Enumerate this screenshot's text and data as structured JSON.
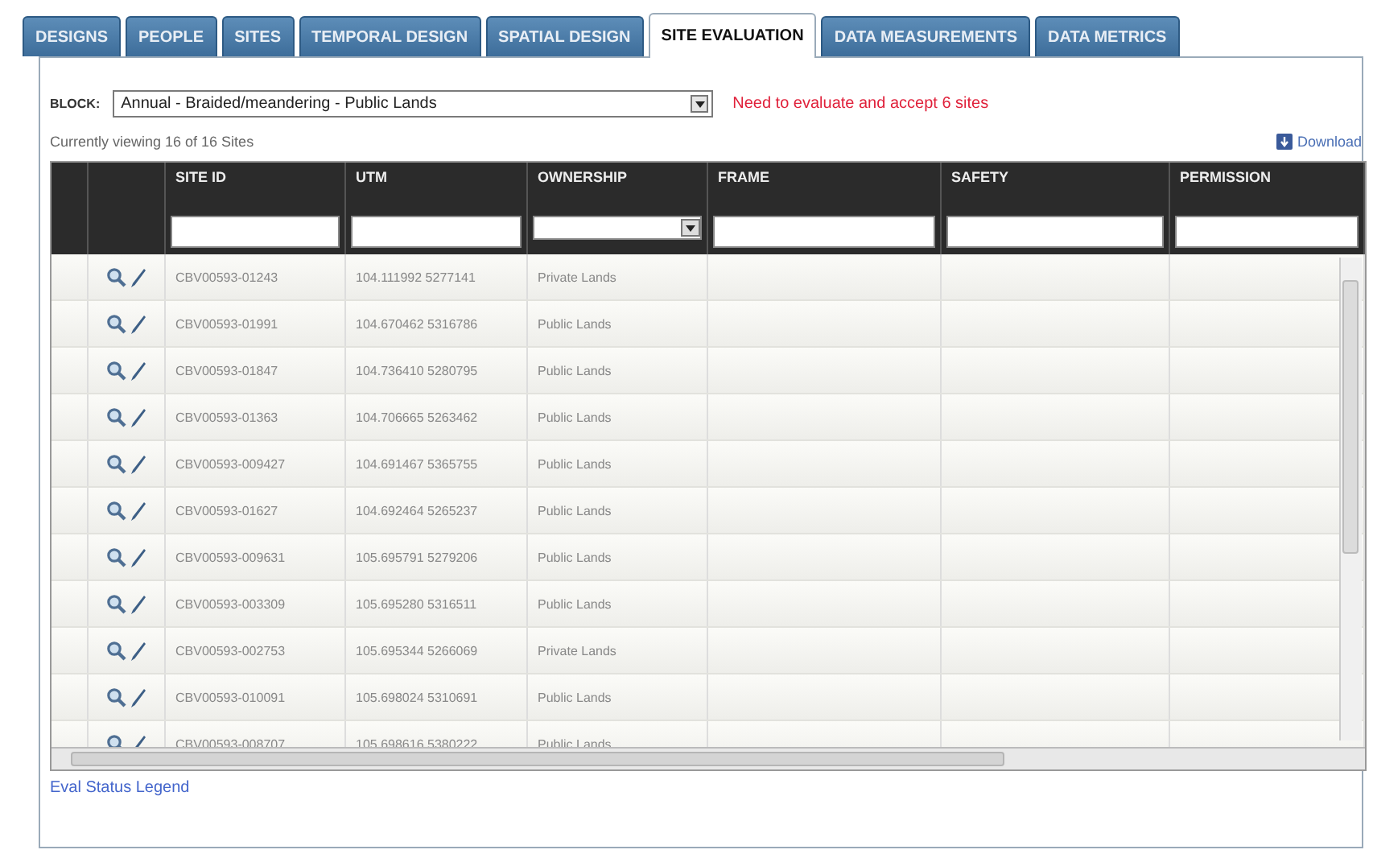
{
  "tabs": [
    {
      "label": "DESIGNS",
      "selected": false
    },
    {
      "label": "PEOPLE",
      "selected": false
    },
    {
      "label": "SITES",
      "selected": false
    },
    {
      "label": "TEMPORAL DESIGN",
      "selected": false
    },
    {
      "label": "SPATIAL DESIGN",
      "selected": false
    },
    {
      "label": "SITE EVALUATION",
      "selected": true
    },
    {
      "label": "DATA MEASUREMENTS",
      "selected": false
    },
    {
      "label": "DATA METRICS",
      "selected": false
    }
  ],
  "block": {
    "label": "BLOCK:",
    "value": "Annual - Braided/meandering - Public Lands",
    "warning": "Need to evaluate and accept 6 sites"
  },
  "viewing": "Currently viewing 16 of 16 Sites",
  "download": "Download",
  "table": {
    "columns": [
      {
        "label": "SITE ID",
        "kind": "text"
      },
      {
        "label": "UTM",
        "kind": "text"
      },
      {
        "label": "OWNERSHIP",
        "kind": "select"
      },
      {
        "label": "FRAME",
        "kind": "text"
      },
      {
        "label": "SAFETY",
        "kind": "text"
      },
      {
        "label": "PERMISSION",
        "kind": "text"
      }
    ],
    "rows": [
      {
        "site_id": "CBV00593-01243",
        "utm": "104.111992 5277141",
        "ownership": "Private Lands"
      },
      {
        "site_id": "CBV00593-01991",
        "utm": "104.670462 5316786",
        "ownership": "Public Lands"
      },
      {
        "site_id": "CBV00593-01847",
        "utm": "104.736410 5280795",
        "ownership": "Public Lands"
      },
      {
        "site_id": "CBV00593-01363",
        "utm": "104.706665 5263462",
        "ownership": "Public Lands"
      },
      {
        "site_id": "CBV00593-009427",
        "utm": "104.691467 5365755",
        "ownership": "Public Lands"
      },
      {
        "site_id": "CBV00593-01627",
        "utm": "104.692464 5265237",
        "ownership": "Public Lands"
      },
      {
        "site_id": "CBV00593-009631",
        "utm": "105.695791 5279206",
        "ownership": "Public Lands"
      },
      {
        "site_id": "CBV00593-003309",
        "utm": "105.695280 5316511",
        "ownership": "Public Lands"
      },
      {
        "site_id": "CBV00593-002753",
        "utm": "105.695344 5266069",
        "ownership": "Private Lands"
      },
      {
        "site_id": "CBV00593-010091",
        "utm": "105.698024 5310691",
        "ownership": "Public Lands"
      },
      {
        "site_id": "CBV00593-008707",
        "utm": "105.698616 5380222",
        "ownership": "Public Lands"
      }
    ]
  },
  "legend_link": "Eval Status Legend"
}
